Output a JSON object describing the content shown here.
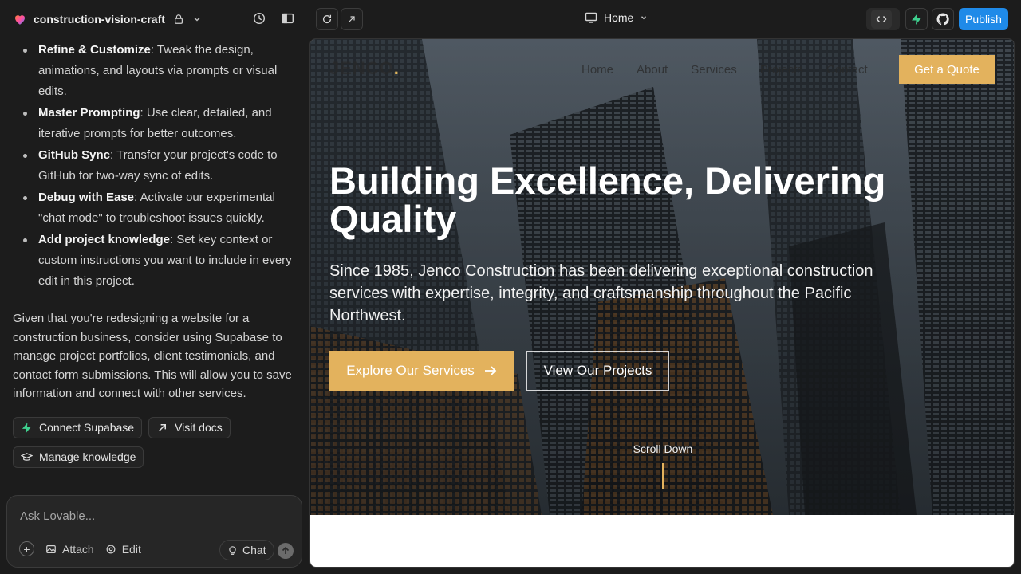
{
  "project": {
    "name": "construction-vision-craft"
  },
  "chat": {
    "bullets": [
      {
        "title": "Refine & Customize",
        "text": ": Tweak the design, animations, and layouts via prompts or visual edits."
      },
      {
        "title": "Master Prompting",
        "text": ": Use clear, detailed, and iterative prompts for better outcomes."
      },
      {
        "title": "GitHub Sync",
        "text": ": Transfer your project's code to GitHub for two-way sync of edits."
      },
      {
        "title": "Debug with Ease",
        "text": ": Activate our experimental \"chat mode\" to troubleshoot issues quickly."
      },
      {
        "title": "Add project knowledge",
        "text": ": Set key context or custom instructions you want to include in every edit in this project."
      }
    ],
    "paragraph": "Given that you're redesigning a website for a construction business, consider using Supabase to manage project portfolios, client testimonials, and contact form submissions. This will allow you to save information and connect with other services.",
    "chips": {
      "supabase": "Connect Supabase",
      "docs": "Visit docs",
      "knowledge": "Manage knowledge"
    }
  },
  "composer": {
    "placeholder": "Ask Lovable...",
    "attach": "Attach",
    "edit": "Edit",
    "chat": "Chat"
  },
  "topbar": {
    "route": "Home",
    "publish": "Publish"
  },
  "site": {
    "logo": "JENCO",
    "nav": [
      "Home",
      "About",
      "Services",
      "Projects",
      "Contact"
    ],
    "quote": "Get a Quote",
    "title": "Building Excellence, Delivering Quality",
    "subtitle": "Since 1985, Jenco Construction has been delivering exceptional construction services with expertise, integrity, and craftsmanship throughout the Pacific Northwest.",
    "cta_primary": "Explore Our Services",
    "cta_secondary": "View Our Projects",
    "scroll": "Scroll Down"
  },
  "colors": {
    "accent": "#e3b25d",
    "publish": "#1f8ae8",
    "supabase": "#3ecf8e"
  }
}
